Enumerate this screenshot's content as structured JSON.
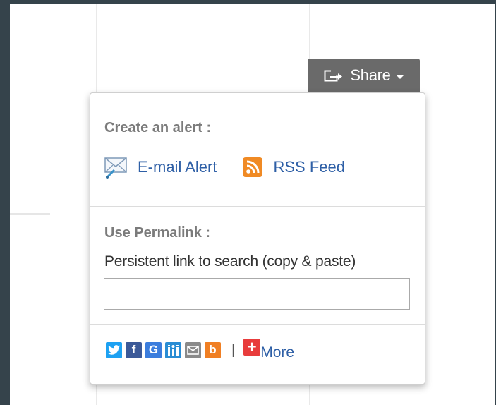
{
  "share_button": {
    "label": "Share",
    "icon": "share-arrow-icon"
  },
  "dropdown": {
    "alert_section": {
      "title": "Create an alert :",
      "email_alert": "E-mail Alert",
      "rss_feed": "RSS Feed"
    },
    "permalink_section": {
      "title": "Use Permalink :",
      "description": "Persistent link to search (copy & paste)",
      "input_value": ""
    },
    "social": {
      "icons": [
        "twitter-icon",
        "facebook-icon",
        "google-icon",
        "mendeley-icon",
        "email-icon",
        "blogger-icon"
      ],
      "separator": "|",
      "more_label": "More"
    }
  },
  "colors": {
    "link": "#2e5fa6",
    "share_button_bg": "#6a6a6a",
    "outer_background": "#35434b",
    "twitter": "#1da1f2",
    "facebook": "#3b5998",
    "google": "#3b7ddd",
    "mendeley": "#2a8dd4",
    "email": "#8a8a8a",
    "blogger": "#f07f23",
    "more": "#e83c3c"
  }
}
